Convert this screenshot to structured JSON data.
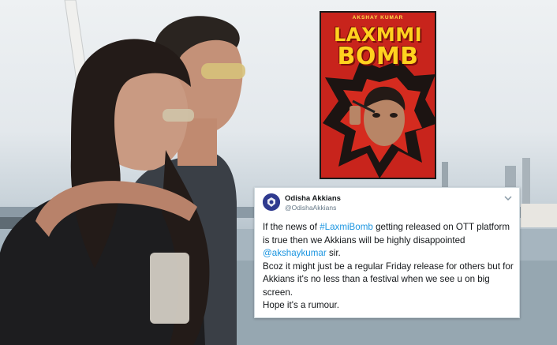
{
  "poster": {
    "actor": "AKSHAY KUMAR",
    "title_line1": "LAXMMI",
    "title_line2": "BOMB",
    "bg_color": "#c8241c",
    "title_color": "#ffd21f"
  },
  "tweet": {
    "display_name": "Odisha Akkians",
    "handle": "@OdishaAkkians",
    "line1_pre": "If the news of ",
    "line1_hashtag": "#LaxmiBomb",
    "line1_post": " getting released on OTT platform is true then we Akkians will be highly disappointed ",
    "line1_mention": "@akshaykumar",
    "line1_end": " sir.",
    "line2": "Bcoz it might just be a regular Friday release for others but for Akkians it's no less than a festival when we see u on big screen.",
    "line3": "Hope it's a rumour.",
    "link_color": "#1b95e0",
    "chevron_icon": "chevron-down-icon"
  }
}
